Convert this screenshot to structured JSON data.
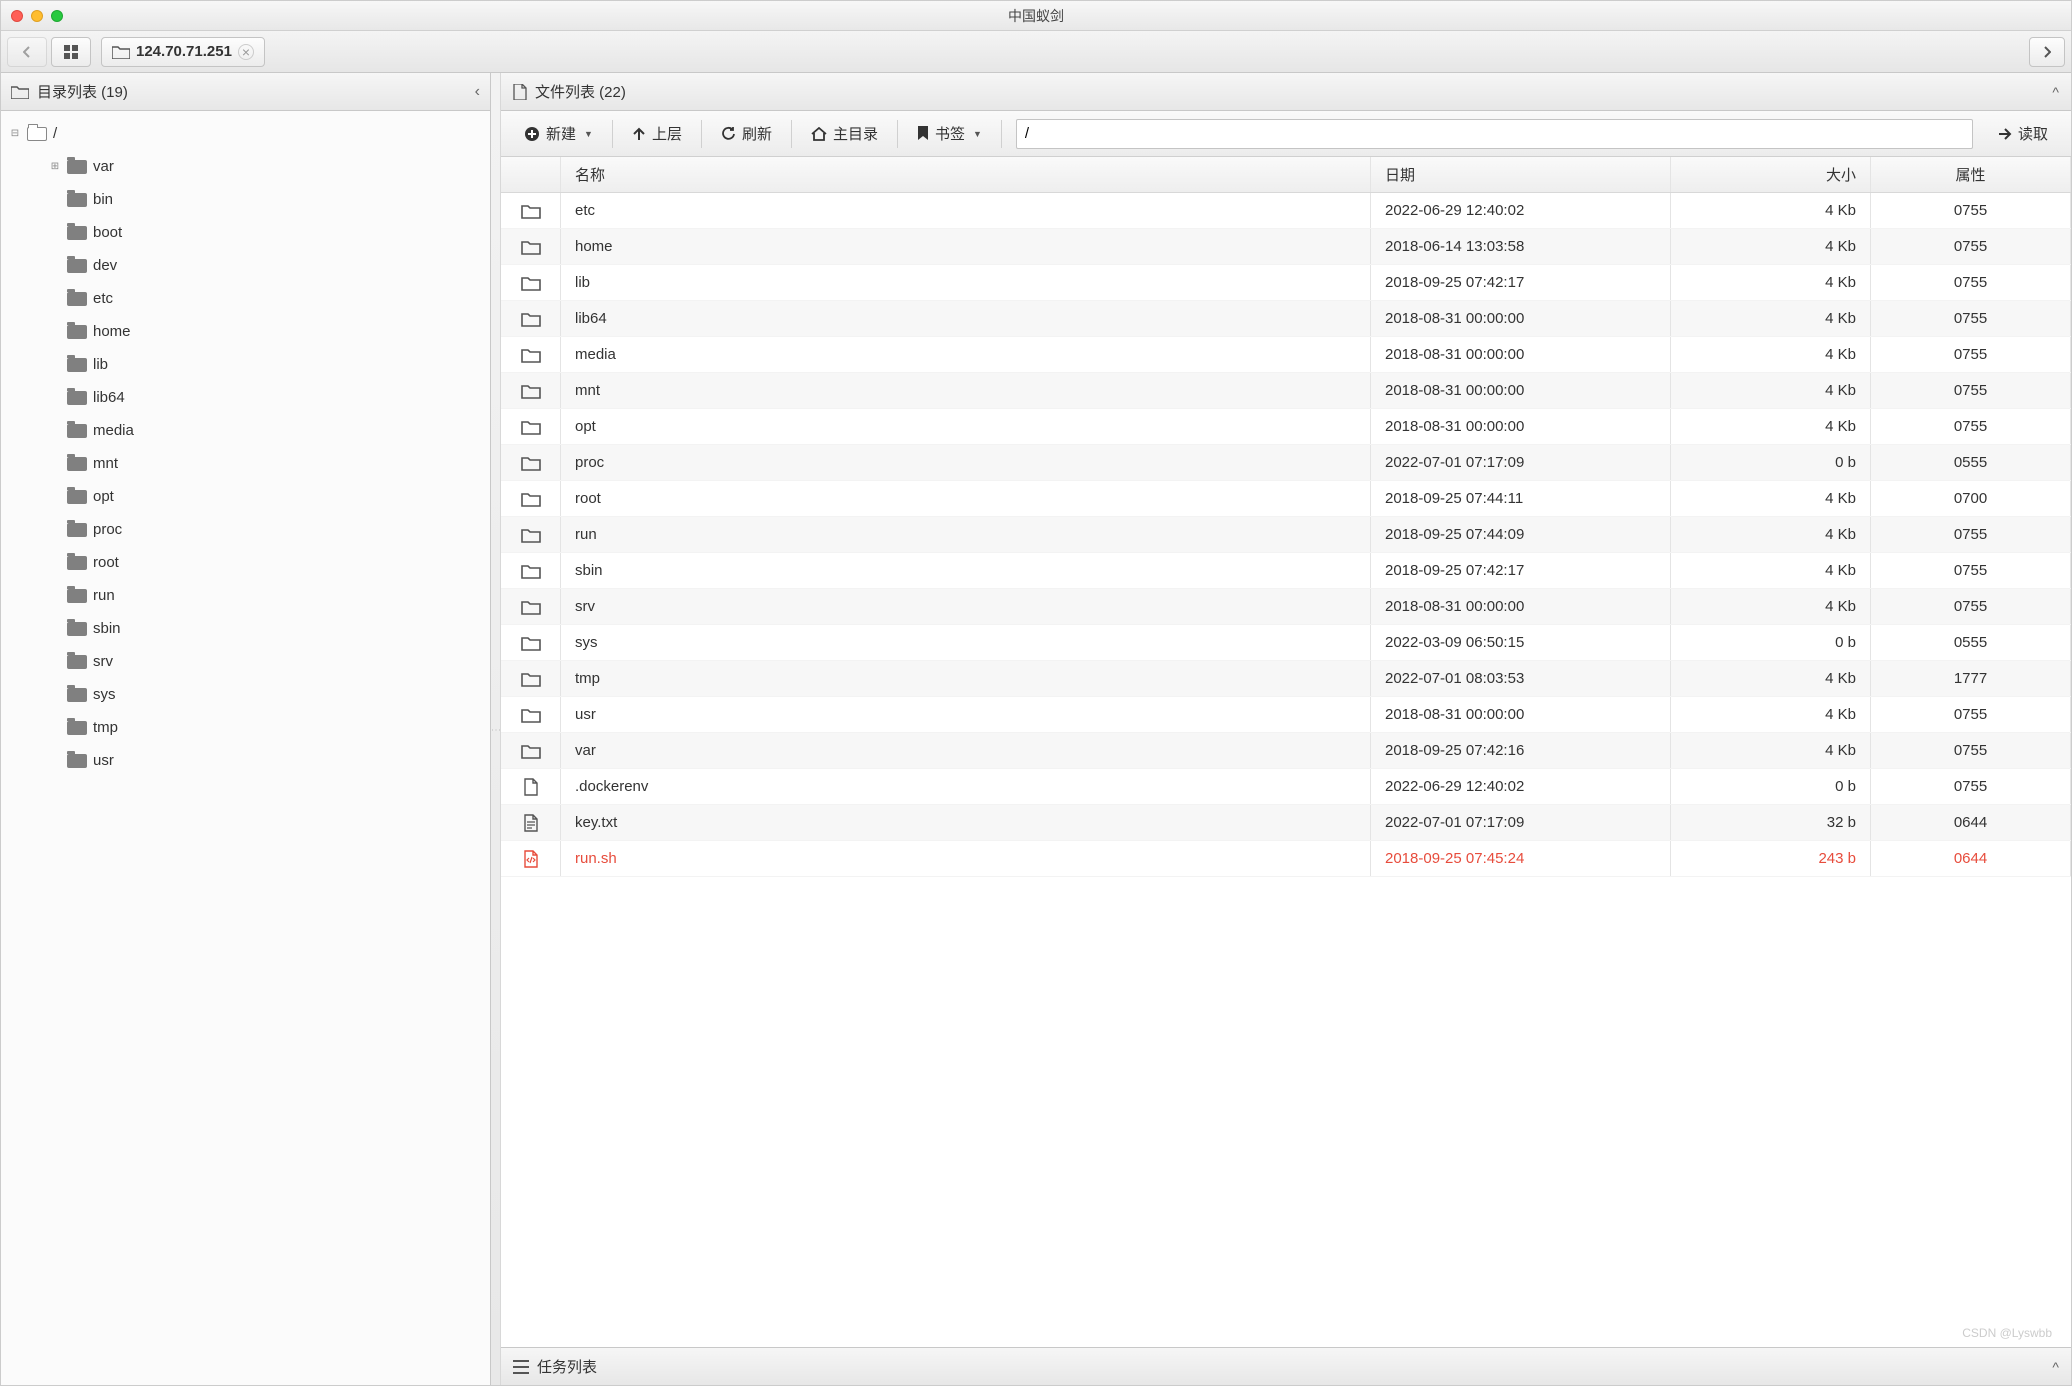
{
  "window": {
    "title": "中国蚁剑"
  },
  "tabs": {
    "active_ip": "124.70.71.251"
  },
  "sidebar": {
    "title": "目录列表 (19)",
    "root": "/",
    "items": [
      {
        "name": "var",
        "expandable": true
      },
      {
        "name": "bin"
      },
      {
        "name": "boot"
      },
      {
        "name": "dev"
      },
      {
        "name": "etc"
      },
      {
        "name": "home"
      },
      {
        "name": "lib"
      },
      {
        "name": "lib64"
      },
      {
        "name": "media"
      },
      {
        "name": "mnt"
      },
      {
        "name": "opt"
      },
      {
        "name": "proc"
      },
      {
        "name": "root"
      },
      {
        "name": "run"
      },
      {
        "name": "sbin"
      },
      {
        "name": "srv"
      },
      {
        "name": "sys"
      },
      {
        "name": "tmp"
      },
      {
        "name": "usr"
      }
    ]
  },
  "filelist": {
    "title": "文件列表 (22)",
    "toolbar": {
      "new": "新建",
      "up": "上层",
      "refresh": "刷新",
      "home": "主目录",
      "bookmark": "书签",
      "read": "读取"
    },
    "path": "/",
    "columns": {
      "name": "名称",
      "date": "日期",
      "size": "大小",
      "attr": "属性"
    },
    "rows": [
      {
        "type": "folder",
        "name": "etc",
        "date": "2022-06-29 12:40:02",
        "size": "4 Kb",
        "attr": "0755"
      },
      {
        "type": "folder",
        "name": "home",
        "date": "2018-06-14 13:03:58",
        "size": "4 Kb",
        "attr": "0755"
      },
      {
        "type": "folder",
        "name": "lib",
        "date": "2018-09-25 07:42:17",
        "size": "4 Kb",
        "attr": "0755"
      },
      {
        "type": "folder",
        "name": "lib64",
        "date": "2018-08-31 00:00:00",
        "size": "4 Kb",
        "attr": "0755"
      },
      {
        "type": "folder",
        "name": "media",
        "date": "2018-08-31 00:00:00",
        "size": "4 Kb",
        "attr": "0755"
      },
      {
        "type": "folder",
        "name": "mnt",
        "date": "2018-08-31 00:00:00",
        "size": "4 Kb",
        "attr": "0755"
      },
      {
        "type": "folder",
        "name": "opt",
        "date": "2018-08-31 00:00:00",
        "size": "4 Kb",
        "attr": "0755"
      },
      {
        "type": "folder",
        "name": "proc",
        "date": "2022-07-01 07:17:09",
        "size": "0 b",
        "attr": "0555"
      },
      {
        "type": "folder",
        "name": "root",
        "date": "2018-09-25 07:44:11",
        "size": "4 Kb",
        "attr": "0700"
      },
      {
        "type": "folder",
        "name": "run",
        "date": "2018-09-25 07:44:09",
        "size": "4 Kb",
        "attr": "0755"
      },
      {
        "type": "folder",
        "name": "sbin",
        "date": "2018-09-25 07:42:17",
        "size": "4 Kb",
        "attr": "0755"
      },
      {
        "type": "folder",
        "name": "srv",
        "date": "2018-08-31 00:00:00",
        "size": "4 Kb",
        "attr": "0755"
      },
      {
        "type": "folder",
        "name": "sys",
        "date": "2022-03-09 06:50:15",
        "size": "0 b",
        "attr": "0555"
      },
      {
        "type": "folder",
        "name": "tmp",
        "date": "2022-07-01 08:03:53",
        "size": "4 Kb",
        "attr": "1777"
      },
      {
        "type": "folder",
        "name": "usr",
        "date": "2018-08-31 00:00:00",
        "size": "4 Kb",
        "attr": "0755"
      },
      {
        "type": "folder",
        "name": "var",
        "date": "2018-09-25 07:42:16",
        "size": "4 Kb",
        "attr": "0755"
      },
      {
        "type": "file",
        "name": ".dockerenv",
        "date": "2022-06-29 12:40:02",
        "size": "0 b",
        "attr": "0755"
      },
      {
        "type": "text",
        "name": "key.txt",
        "date": "2022-07-01 07:17:09",
        "size": "32 b",
        "attr": "0644"
      },
      {
        "type": "code",
        "name": "run.sh",
        "date": "2018-09-25 07:45:24",
        "size": "243 b",
        "attr": "0644",
        "highlight": true
      }
    ]
  },
  "taskbar": {
    "title": "任务列表"
  },
  "watermark": "CSDN @Lyswbb"
}
